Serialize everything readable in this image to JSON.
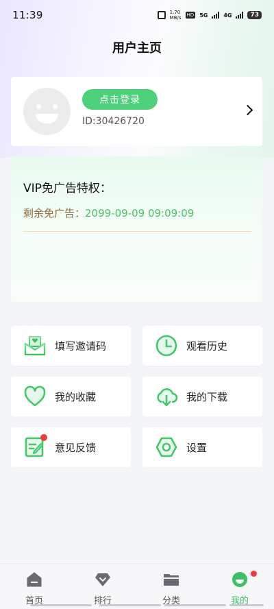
{
  "status_bar": {
    "time": "11:39",
    "net_speed_value": "1.70",
    "net_speed_unit": "MB/s",
    "hd_label": "HD",
    "net_5g": "5G",
    "net_4g": "4G",
    "battery": "73"
  },
  "header": {
    "title": "用户主页"
  },
  "profile": {
    "login_label": "点击登录",
    "user_id": "ID:30426720"
  },
  "vip": {
    "title": "VIP免广告特权：",
    "remaining_label": "剩余免广告：",
    "remaining_date": "2099-09-09 09:09:09"
  },
  "menu": {
    "invite_code": "填写邀请码",
    "history": "观看历史",
    "favorites": "我的收藏",
    "downloads": "我的下载",
    "feedback": "意见反馈",
    "settings": "设置"
  },
  "tabs": {
    "home": "首页",
    "ranking": "排行",
    "category": "分类",
    "mine": "我的"
  },
  "colors": {
    "accent_green": "#4cd17a",
    "vip_label": "#8a6d3b",
    "notification_red": "#ee3b3b"
  }
}
